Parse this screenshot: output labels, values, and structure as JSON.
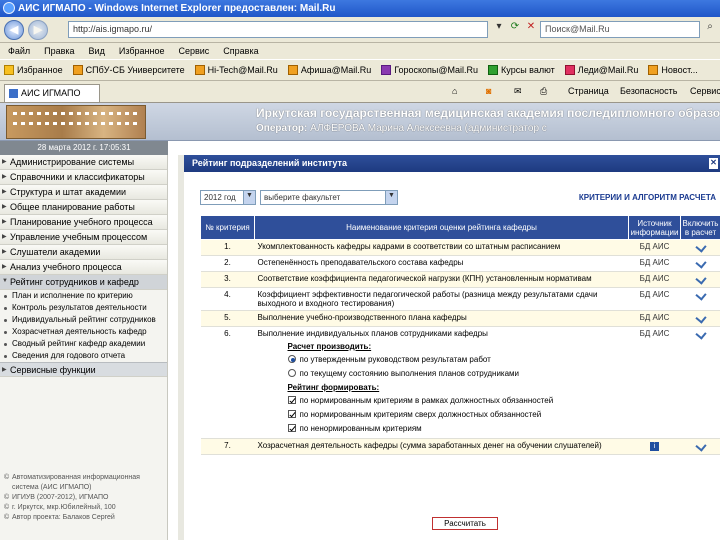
{
  "window": {
    "title": "АИС ИГМАПО - Windows Internet Explorer предоставлен: Mail.Ru",
    "address": "http://ais.igmapo.ru/",
    "search_placeholder": "Поиск@Mail.Ru"
  },
  "menu": [
    "Файл",
    "Правка",
    "Вид",
    "Избранное",
    "Сервис",
    "Справка"
  ],
  "favorites": {
    "label": "Избранное",
    "items": [
      "СПбУ-СБ Университете",
      "Hi-Tech@Mail.Ru",
      "Афиша@Mail.Ru",
      "Гороскопы@Mail.Ru",
      "Курсы валют",
      "Леди@Mail.Ru",
      "Новост..."
    ]
  },
  "tab": {
    "label": "АИС ИГМАПО",
    "commands": [
      "Страница",
      "Безопасность",
      "Сервис"
    ]
  },
  "header": {
    "org_title": "Иркутская государственная медицинская академия последипломного образо",
    "operator_label": "Оператор:",
    "operator_name": "АЛФЕРОВА Марина Алексеевна (администратор с"
  },
  "date": "28 марта 2012 г. 17:05:31",
  "sidebar": {
    "items": [
      "Администрирование системы",
      "Справочники и классификаторы",
      "Структура и штат академии",
      "Общее планирование работы",
      "Планирование учебного процесса",
      "Управление учебным процессом",
      "Слушатели академии",
      "Анализ учебного процесса"
    ],
    "open_item": "Рейтинг сотрудников и кафедр",
    "subitems": [
      "План и исполнение по критерию",
      "Контроль результатов деятельности",
      "Индивидуальный рейтинг сотрудников",
      "Хозрасчетная деятельность кафедр",
      "Сводный рейтинг кафедр академии",
      "Сведения для годового отчета"
    ],
    "service_item": "Сервисные функции",
    "footer": [
      "Автоматизированная информационная система (АИС ИГМАПО)",
      "ИГИУВ (2007-2012), ИГМАПО",
      "г. Иркутск, мкр.Юбилейный, 100",
      "Автор проекта: Балаков Сергей"
    ]
  },
  "main": {
    "panel_title": "Рейтинг подразделений института",
    "year_select": "2012 год",
    "dept_select": "выберите факультет",
    "algo_link": "КРИТЕРИИ И АЛГОРИТМ РАСЧЕТА",
    "columns": [
      "№ критерия",
      "Наименование критерия оценки рейтинга кафедры",
      "Источник информации",
      "Включить в расчет"
    ],
    "rows": [
      {
        "num": "1.",
        "name": "Укомплектованность кафедры кадрами в соответствии со штатным расписанием",
        "src": "БД АИС"
      },
      {
        "num": "2.",
        "name": "Остепенённость преподавательского состава кафедры",
        "src": "БД АИС"
      },
      {
        "num": "3.",
        "name": "Соответствие коэффициента педагогической нагрузки (КПН) установленным нормативам",
        "src": "БД АИС"
      },
      {
        "num": "4.",
        "name": "Коэффициент эффективности педагогической работы (разница между результатами сдачи выходного и входного тестирования)",
        "src": "БД АИС"
      },
      {
        "num": "5.",
        "name": "Выполнение учебно-производственного плана кафедры",
        "src": "БД АИС"
      },
      {
        "num": "6.",
        "name": "Выполнение индивидуальных планов сотрудниками кафедры",
        "src": "БД АИС"
      },
      {
        "num": "7.",
        "name": "Хозрасчетная деятельность кафедры (сумма заработанных денег на обучении слушателей)",
        "src": "БД АИС"
      }
    ],
    "calc_mode_title": "Расчет производить:",
    "calc_modes": [
      "по утвержденным руководством результатам работ",
      "по текущему состоянию выполнения планов сотрудниками"
    ],
    "rating_mode_title": "Рейтинг формировать:",
    "rating_modes": [
      "по нормированным критериям в рамках должностных обязанностей",
      "по нормированным критериям сверх должностных обязанностей",
      "по ненормированным критериям"
    ],
    "info_icon": "i",
    "calc_button": "Рассчитать"
  }
}
